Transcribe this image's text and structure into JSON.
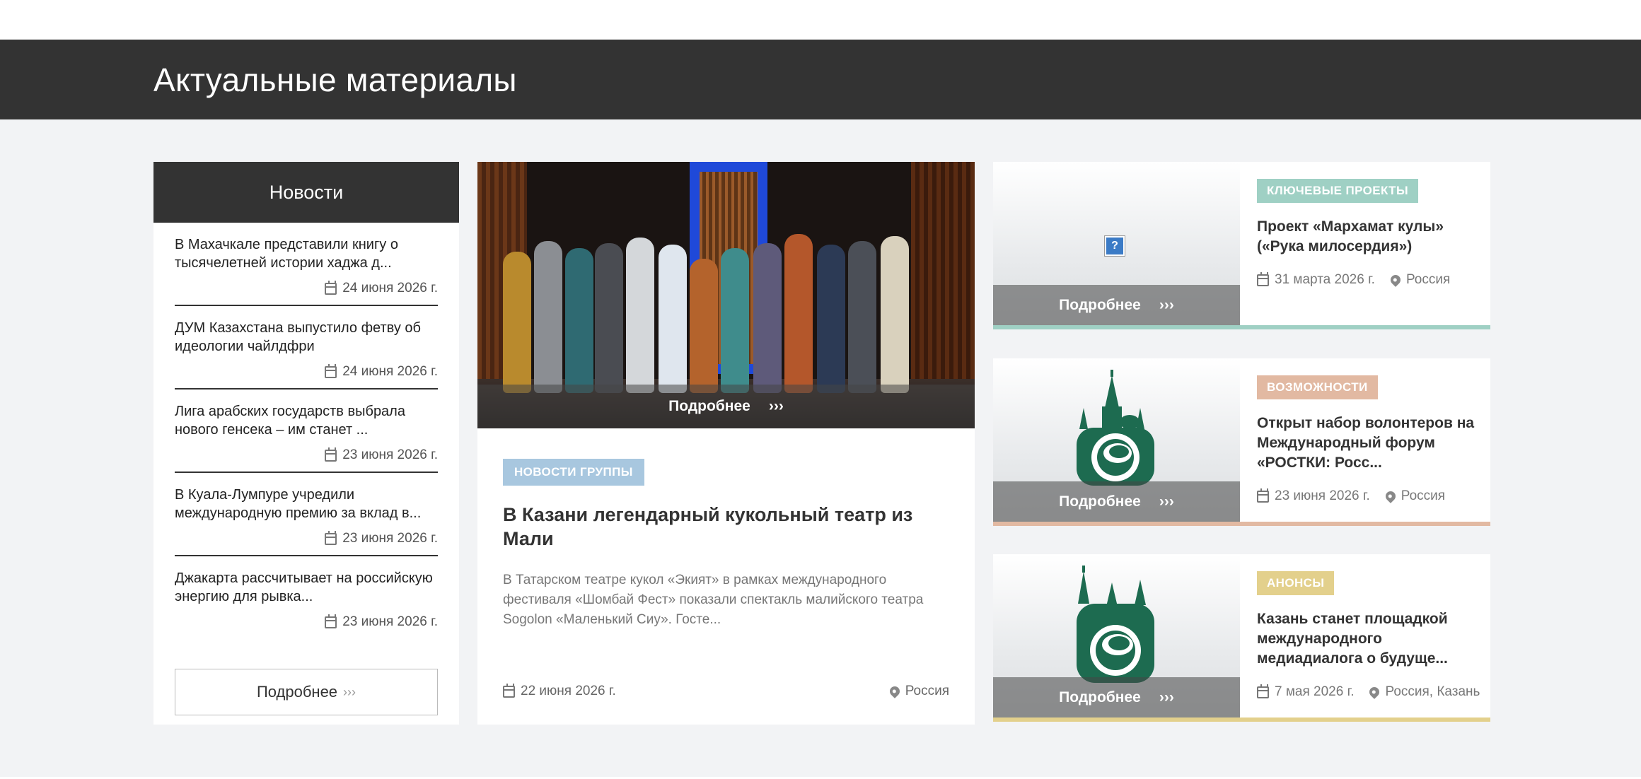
{
  "banner": {
    "title": "Актуальные материалы"
  },
  "news": {
    "heading": "Новости",
    "items": [
      {
        "title": "В Махачкале представили книгу о тысячелетней истории хаджа д...",
        "date": "24 июня 2026 г."
      },
      {
        "title": "ДУМ Казахстана выпустило фетву об идеологии чайлдфри",
        "date": "24 июня 2026 г."
      },
      {
        "title": "Лига арабских государств выбрала нового генсека – им станет ...",
        "date": "23 июня 2026 г."
      },
      {
        "title": "В Куала-Лумпуре учредили международную премию за вклад в...",
        "date": "23 июня 2026 г."
      },
      {
        "title": "Джакарта рассчитывает на российскую энергию для рывка...",
        "date": "23 июня 2026 г."
      }
    ],
    "more_label": "Подробнее",
    "more_arrows": "›››"
  },
  "featured": {
    "more_label": "Подробнее",
    "more_arrows": "›››",
    "tag": "Новости группы",
    "title": "В Казани легендарный кукольный театр из Мали",
    "text": "В Татарском театре кукол «Экият» в рамках международного фестиваля «Шомбай Фест» показали спектакль малийского театра Sogolon «Маленький Сиу». Госте...",
    "date": "22 июня 2026 г.",
    "location": "Россия",
    "accent": "#a8c7df"
  },
  "cards": [
    {
      "tag": "Ключевые проекты",
      "tag_color": "#9fd0c4",
      "title": "Проект «Мархамат кулы» («Рука милосердия»)",
      "date": "31 марта 2026 г.",
      "location": "Россия",
      "more_label": "Подробнее",
      "more_arrows": "›››",
      "image": "broken-image-icon",
      "broken_image_glyph": "?"
    },
    {
      "tag": "Возможности",
      "tag_color": "#e2b9a2",
      "title": "Открыт набор волонтеров на Международный форум «РОСТКИ: Росс...",
      "date": "23 июня 2026 г.",
      "location": "Россия",
      "more_label": "Подробнее",
      "more_arrows": "›››",
      "image": "kremlin-logo"
    },
    {
      "tag": "Анонсы",
      "tag_color": "#e3d08c",
      "title": "Казань станет площадкой международного медиадиалога о будуще...",
      "date": "7 мая 2026 г.",
      "location": "Россия, Казань",
      "more_label": "Подробнее",
      "more_arrows": "›››",
      "image": "kremlin-logo"
    }
  ]
}
